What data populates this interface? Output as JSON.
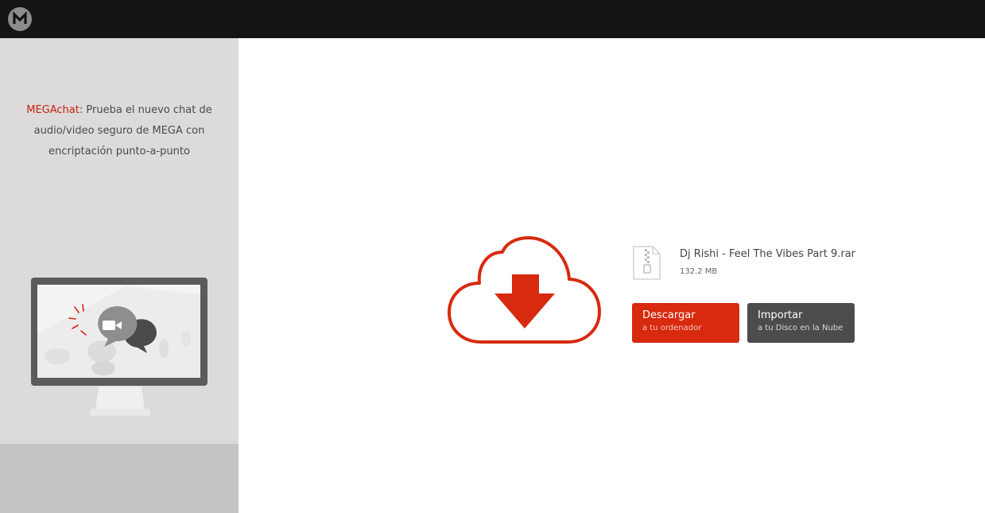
{
  "header": {
    "logo_icon": "mega-logo-icon"
  },
  "sidebar": {
    "promo_brand": "MEGAchat",
    "promo_text": ": Prueba el nuevo chat de audio/video seguro de MEGA con encriptación punto-a-punto",
    "illustration_icon": "monitor-video-chat-icon"
  },
  "download": {
    "cloud_icon": "cloud-download-icon",
    "file_icon": "zip-file-icon",
    "file_name": "Dj Rishi - Feel The Vibes Part 9.rar",
    "file_size": "132.2 MB",
    "download_button": {
      "label": "Descargar",
      "sublabel": "a tu ordenador"
    },
    "import_button": {
      "label": "Importar",
      "sublabel": "a tu Disco en la Nube"
    }
  },
  "colors": {
    "accent": "#d72a0e",
    "topbar": "#151313",
    "sidebar": "#dcdadb",
    "import_button": "#4c4c4c"
  }
}
